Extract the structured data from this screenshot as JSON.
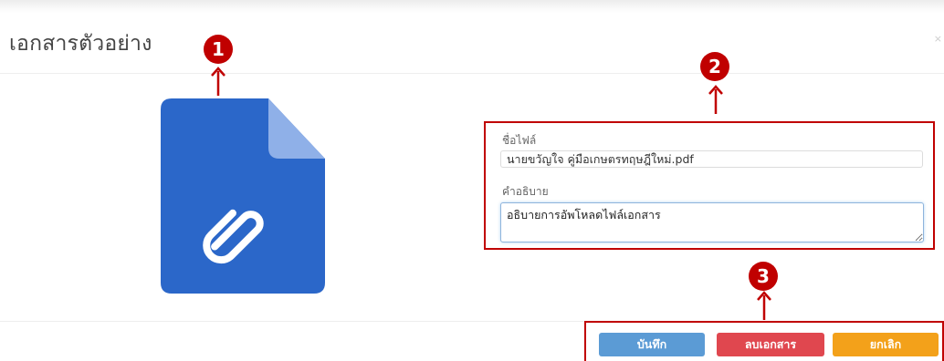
{
  "modal": {
    "title": "เอกสารตัวอย่าง",
    "close_label": "×"
  },
  "markers": {
    "one": "1",
    "two": "2",
    "three": "3"
  },
  "form": {
    "filename_label": "ชื่อไฟล์",
    "filename_value": "นายขวัญใจ คู่มือเกษตรทฤษฎีใหม่.pdf",
    "description_label": "คำอธิบาย",
    "description_value": "อธิบายการอัพโหลดไฟล์เอกสาร"
  },
  "buttons": {
    "save_label": "บันทึก",
    "delete_label": "ลบเอกสาร",
    "cancel_label": "ยกเลิก"
  },
  "colors": {
    "marker_red": "#c00000",
    "doc_icon_blue": "#2b67c9",
    "doc_fold_blue": "#8fb0e8",
    "save_blue": "#5b9bd5",
    "delete_red": "#e0474f",
    "cancel_orange": "#f3a11a"
  },
  "icons": {
    "document": "document-attachment-icon",
    "attachment": "paperclip-icon",
    "arrow": "arrow-up-icon"
  }
}
